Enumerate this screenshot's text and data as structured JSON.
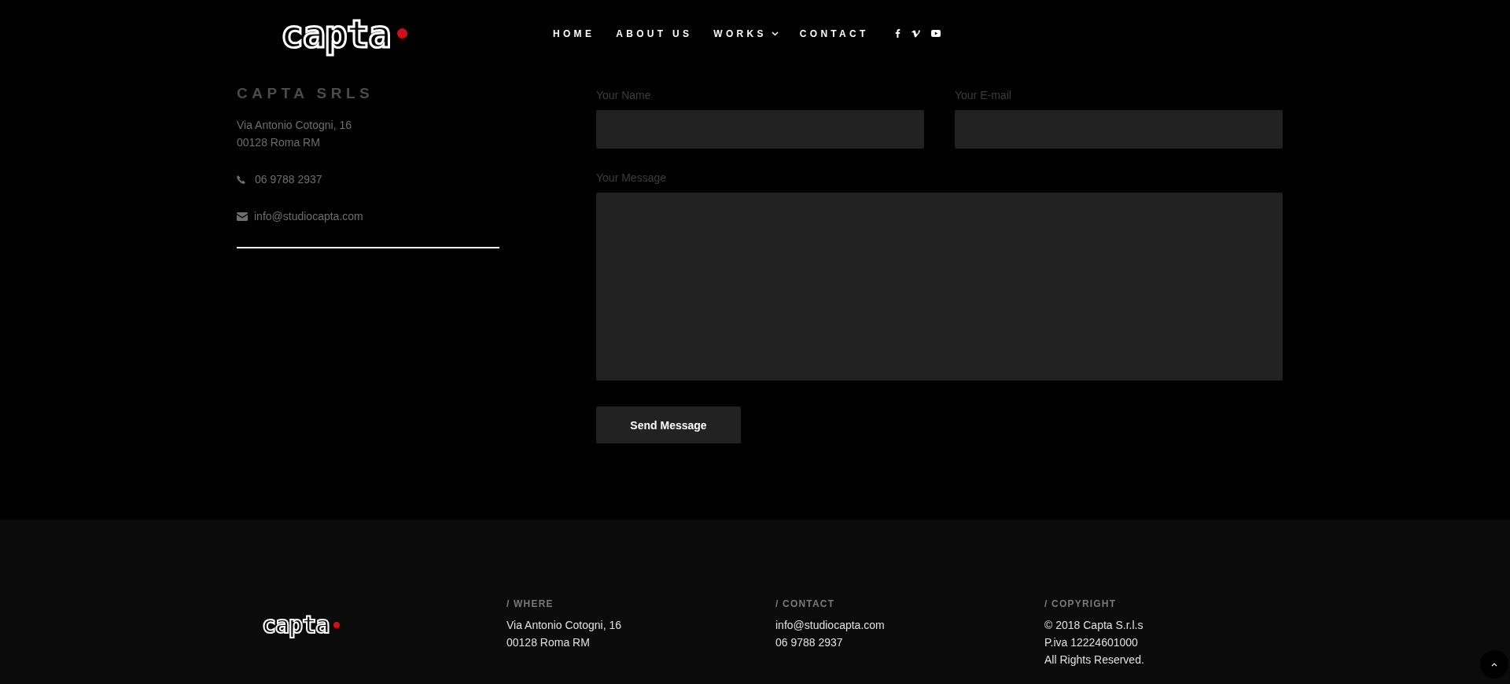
{
  "header": {
    "logo": "capta",
    "nav": [
      {
        "label": "HOME",
        "dropdown": false
      },
      {
        "label": "ABOUT US",
        "dropdown": false
      },
      {
        "label": "WORKS",
        "dropdown": true
      },
      {
        "label": "CONTACT",
        "dropdown": false
      }
    ],
    "social": [
      {
        "kind": "facebook"
      },
      {
        "kind": "vimeo"
      },
      {
        "kind": "youtube"
      }
    ]
  },
  "contact_info": {
    "company": "CAPTA SRLS",
    "address_lines": [
      "Via Antonio Cotogni, 16",
      "00128 Roma RM"
    ],
    "phone": "06 9788 2937",
    "email": "info@studiocapta.com"
  },
  "form": {
    "name_label": "Your Name",
    "email_label": "Your E-mail",
    "message_label": "Your Message",
    "submit": "Send Message"
  },
  "footer": {
    "logo": "capta",
    "columns": [
      {
        "heading": "/ WHERE",
        "lines": [
          "Via Antonio Cotogni, 16",
          "00128 Roma RM"
        ]
      },
      {
        "heading": "/ CONTACT",
        "lines": [
          "info@studiocapta.com",
          "06 9788 2937"
        ]
      },
      {
        "heading": "/ COPYRIGHT",
        "lines": [
          "© 2018 Capta S.r.l.s",
          "P.iva 12224601000",
          "All Rights Reserved."
        ]
      }
    ]
  }
}
